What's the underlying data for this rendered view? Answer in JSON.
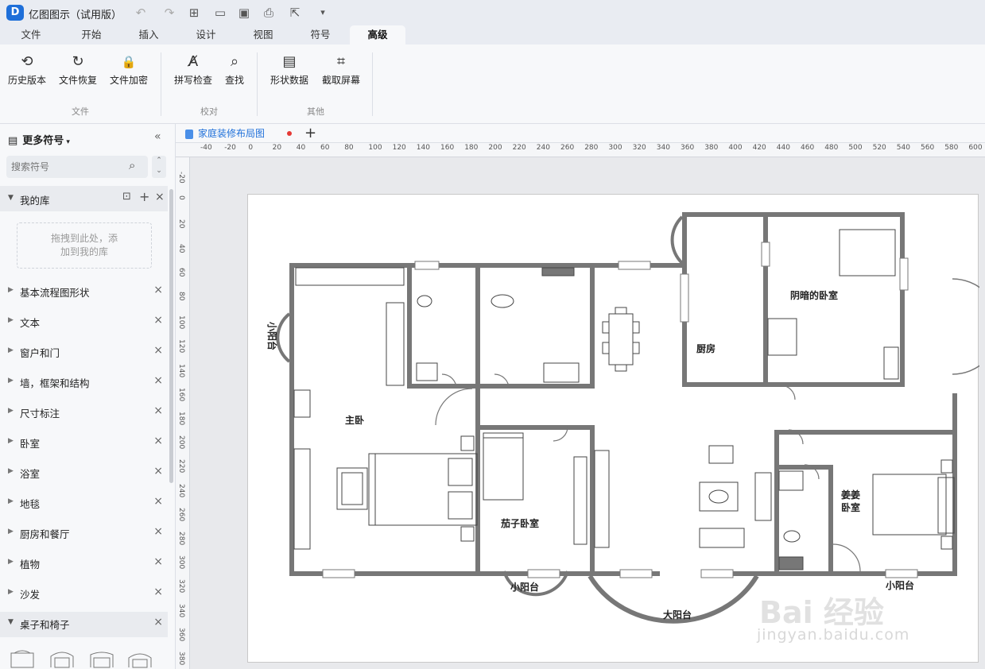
{
  "app": {
    "logo": "D",
    "title": "亿图图示（试用版）"
  },
  "quick_access": [
    "undo-icon",
    "redo-icon",
    "new-icon",
    "open-icon",
    "save-icon",
    "print-icon",
    "export-icon",
    "more-icon"
  ],
  "menu": {
    "tabs": [
      "文件",
      "开始",
      "插入",
      "设计",
      "视图",
      "符号",
      "高级"
    ],
    "active": "高级"
  },
  "ribbon": {
    "buttons": [
      {
        "label": "历史版本",
        "icon": "history-icon",
        "glyph": "⟲"
      },
      {
        "label": "文件恢复",
        "icon": "refresh-icon",
        "glyph": "↻"
      },
      {
        "label": "文件加密",
        "icon": "lock-icon",
        "glyph": "🔒"
      },
      {
        "label": "拼写检查",
        "icon": "spellcheck-icon",
        "glyph": "A̸"
      },
      {
        "label": "查找",
        "icon": "find-icon",
        "glyph": "⌕"
      },
      {
        "label": "形状数据",
        "icon": "shape-data-icon",
        "glyph": "▤"
      },
      {
        "label": "截取屏幕",
        "icon": "crop-icon",
        "glyph": "⌗"
      }
    ],
    "groups": [
      "文件",
      "校对",
      "其他"
    ]
  },
  "left_panel": {
    "header": "更多符号",
    "search_placeholder": "搜索符号",
    "my_library": "我的库",
    "drop_hint_line1": "拖拽到此处，添",
    "drop_hint_line2": "加到我的库",
    "libraries": [
      "基本流程图形状",
      "文本",
      "窗户和门",
      "墙，框架和结构",
      "尺寸标注",
      "卧室",
      "浴室",
      "地毯",
      "厨房和餐厅",
      "植物",
      "沙发",
      "桌子和椅子"
    ]
  },
  "document": {
    "tab_title": "家庭装修布局图"
  },
  "ruler": {
    "h_labels": [
      "-40",
      "-20",
      "0",
      "20",
      "40",
      "60",
      "80",
      "100",
      "120",
      "140",
      "160",
      "180",
      "200",
      "220",
      "240",
      "260",
      "280",
      "300",
      "320",
      "340",
      "360",
      "380",
      "400",
      "420",
      "440",
      "460",
      "480",
      "500",
      "520",
      "540",
      "560",
      "580",
      "600"
    ],
    "v_labels": [
      "-20",
      "0",
      "20",
      "40",
      "60",
      "80",
      "100",
      "120",
      "140",
      "160",
      "180",
      "200",
      "220",
      "240",
      "260",
      "280",
      "300",
      "320",
      "340",
      "360",
      "380"
    ]
  },
  "floor_plan": {
    "rooms": {
      "master": "主卧",
      "small_balcony_left": "小阳台",
      "dark_bedroom": "阴暗的卧室",
      "kitchen": "厨房",
      "eggplant_bedroom": "茄子卧室",
      "couple_l1": "姜姜",
      "couple_l2": "卧室",
      "small_balcony_mid": "小阳台",
      "big_balcony": "大阳台",
      "small_balcony_right": "小阳台"
    },
    "wall_color": "#777777"
  },
  "watermark": {
    "main": "Bai 经验",
    "sub": "jingyan.baidu.com"
  }
}
